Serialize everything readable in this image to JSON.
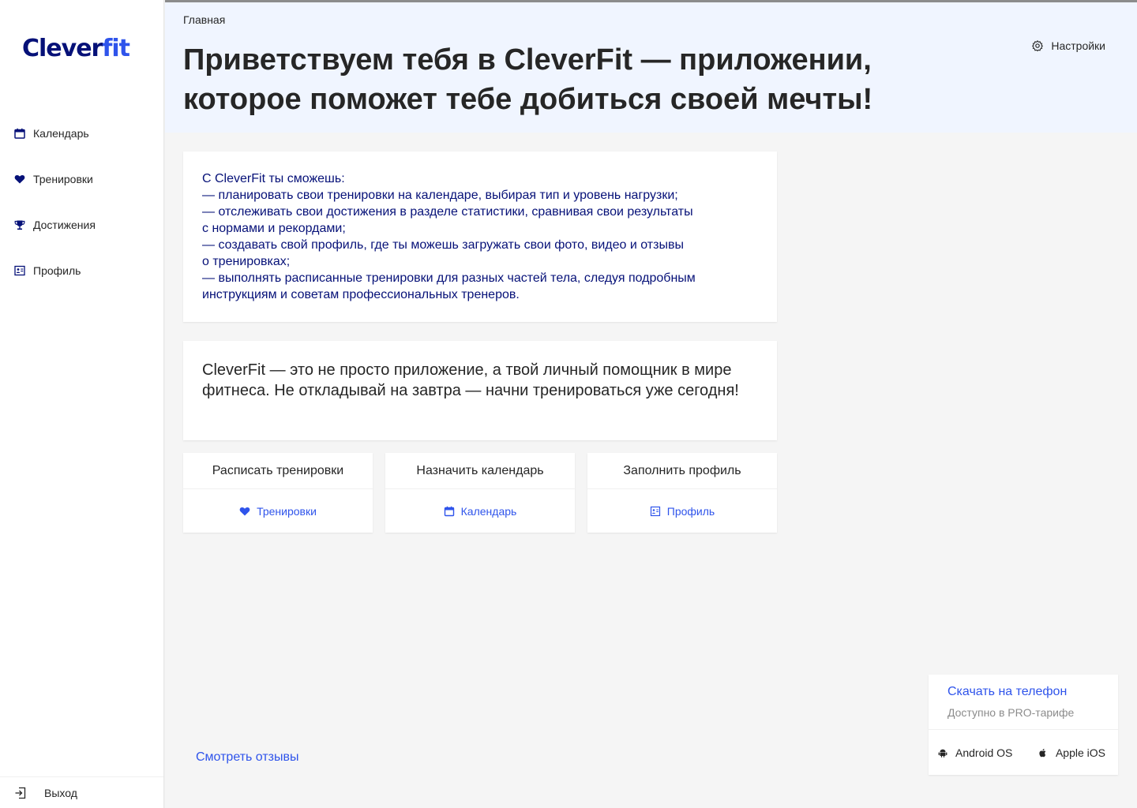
{
  "brand": {
    "logo_part1": "Clever",
    "logo_part2": "fit"
  },
  "sidebar": {
    "items": [
      {
        "label": "Календарь",
        "icon": "calendar-icon"
      },
      {
        "label": "Тренировки",
        "icon": "heart-icon"
      },
      {
        "label": "Достижения",
        "icon": "trophy-icon"
      },
      {
        "label": "Профиль",
        "icon": "idcard-icon"
      }
    ],
    "logout_label": "Выход"
  },
  "header": {
    "breadcrumb": "Главная",
    "settings_label": "Настройки",
    "title": "Приветствуем тебя в CleverFit — приложении, которое поможет тебе добиться своей мечты!"
  },
  "info_card": {
    "lines": [
      "С CleverFit ты сможешь:",
      "— планировать свои тренировки на календаре, выбирая тип и уровень нагрузки;",
      "— отслеживать свои достижения в разделе статистики, сравнивая свои результаты",
      "с нормами и рекордами;",
      "— создавать свой профиль, где ты можешь загружать свои фото, видео и отзывы",
      "о тренировках;",
      "— выполнять расписанные тренировки для разных частей тела, следуя подробным",
      "инструкциям и советам профессиональных тренеров."
    ]
  },
  "promo_card": {
    "text": "CleverFit — это не просто приложение, а твой личный помощник в мире фитнеса. Не откладывай на завтра — начни тренироваться уже сегодня!"
  },
  "actions": [
    {
      "title": "Расписать тренировки",
      "link": "Тренировки",
      "icon": "heart-icon"
    },
    {
      "title": "Назначить календарь",
      "link": "Календарь",
      "icon": "calendar-icon"
    },
    {
      "title": "Заполнить профиль",
      "link": "Профиль",
      "icon": "idcard-icon"
    }
  ],
  "reviews_link": "Смотреть отзывы",
  "download": {
    "title": "Скачать на телефон",
    "subtitle": "Доступно в PRO-тарифе",
    "android_label": "Android OS",
    "ios_label": "Apple iOS"
  },
  "colors": {
    "primary": "#2f54eb",
    "dark_blue": "#061178",
    "header_bg": "#f0f5ff",
    "main_bg": "#f5f5f5"
  }
}
